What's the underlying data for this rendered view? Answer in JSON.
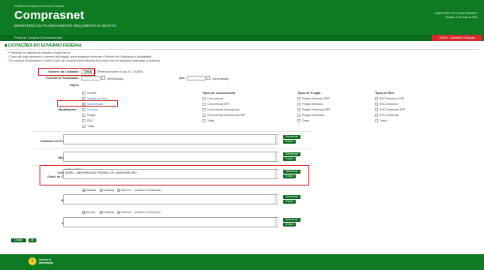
{
  "header": {
    "portal_small": "Portal de Compras do Governo Federal",
    "title": "Comprasnet",
    "ministry": "MINISTÉRIO DO PLANEJAMENTO ORÇAMENTO E GESTÃO",
    "right_line1": "MINISTÉRIO DO PLANEJAMENTO",
    "right_line2": "Brasília, 27 de Maio de 2016",
    "accent": "#0e7a23"
  },
  "strip": {
    "link": "Portal de Compras Governamentais",
    "badge": "SIASG - Ambiente Produção"
  },
  "section": {
    "title": "LICITAÇÕES DO GOVERNO FEDERAL",
    "instructions": [
      "Preencha os critérios de seleção e clique em ok.",
      "Caso não seja informado o número da licitação, será obrigatório informar o Período de Publicação e Modalidade.",
      "Os campos de Município e UASG (Unid. de Compra) serão filtrados de acordo com as licitações publicadas no sistema."
    ]
  },
  "form": {
    "numero_label": "Número da Licitação:",
    "numero_value": "72016",
    "numero_hint": "(Preencha número e ano. Ex: 102005)",
    "periodo_label": "Período de Publicação:",
    "periodo_hint": "(dd/mm/aaaa)",
    "ate_label": "Até:",
    "ate_hint": "(dd/mm/aaaa)",
    "objeto_label": "Objeto",
    "modalidades_label": "Modalidades",
    "modalidades": [
      "Convite",
      "Tomada de Preço",
      "Concorrência",
      "Concurso",
      "Pregão",
      "RDC",
      "Todas"
    ],
    "tipos_concorrencia_title": "Tipos de Concorrência",
    "tipos_concorrencia": [
      "Concorrência",
      "Concorrência SRP",
      "Concorrência Internacional",
      "Concorrência Internacional SRP",
      "Todas"
    ],
    "tipos_pregao_title": "Tipos de Pregão",
    "tipos_pregao": [
      "Pregão Eletrônico SRP",
      "Pregão Eletrônico",
      "Pregão Presencial SRP",
      "Pregão Presencial",
      "Todos"
    ],
    "tipos_rdc_title": "Tipos de RDC",
    "tipos_rdc": [
      "RDC Eletrônico SRP",
      "RDC Eletrônico",
      "RDC Presencial SRP",
      "RDC Presencial",
      "Todos"
    ],
    "uf_label": "Unidades da Federação:",
    "municipios_label": "Municípios:",
    "uasg_label_1": "Cód. UASG",
    "uasg_label_2": "(Unid. de Compra)",
    "uasg_header": "Código  |  UASG",
    "uasg_value": "153032 - UNIVERSIDADE FEDERAL DE LAVRAS/MEC/MG",
    "materiais_label": "Materiais:",
    "materiais_radios": [
      "Material",
      "Catálogo",
      "Nenhum"
    ],
    "materiais_hint": "(máximo 20 Materiais)",
    "servicos_label": "Serviços:",
    "servicos_radios": [
      "Serviço",
      "Catálogo",
      "Nenhum"
    ],
    "servicos_hint": "(máximo 20 Serviços)",
    "btn_selecionar": "Selecionar",
    "btn_excluir": "Excluir",
    "btn_limpar": "Limpar",
    "btn_ok": "OK"
  },
  "footer": {
    "text": "Acesso à Informação"
  }
}
